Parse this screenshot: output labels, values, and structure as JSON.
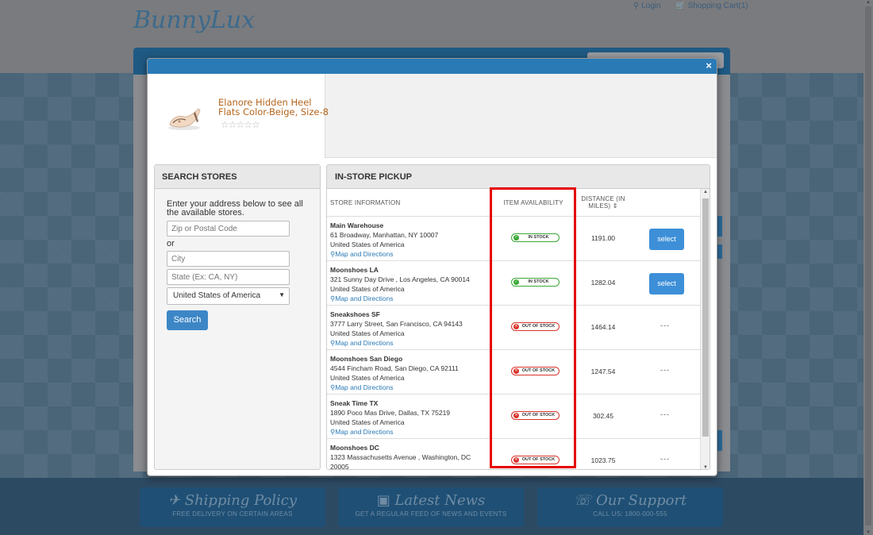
{
  "background": {
    "logo": "BunnyLux",
    "links": {
      "login": "Login",
      "cart": "Shopping Cart(1)"
    },
    "footer": [
      {
        "title": "Shipping Policy",
        "sub": "FREE DELIVERY ON CERTAIN AREAS"
      },
      {
        "title": "Latest News",
        "sub": "GET A REGULAR FEED OF NEWS AND EVENTS"
      },
      {
        "title": "Our Support",
        "sub": "CALL US: 1800-000-555"
      }
    ]
  },
  "modal": {
    "close_label": "×",
    "product": {
      "name": "Elanore Hidden Heel Flats Color-Beige, Size-8",
      "stars": "☆☆☆☆☆"
    },
    "search": {
      "title": "SEARCH STORES",
      "intro": "Enter your address below to see all the available stores.",
      "zip_placeholder": "Zip or Postal Code",
      "or": "or",
      "city_placeholder": "City",
      "state_placeholder": "State (Ex: CA, NY)",
      "country": "United States of America",
      "button": "Search"
    },
    "pickup": {
      "title": "IN-STORE PICKUP",
      "headers": {
        "store": "STORE INFORMATION",
        "availability": "ITEM AVAILABILITY",
        "distance": "DISTANCE (IN MILES)"
      },
      "stores": [
        {
          "name": "Main Warehouse",
          "address": "61 Broadway, Manhattan, NY 10007",
          "country": "United States of America",
          "link": "Map and Directions",
          "availability": "IN STOCK",
          "distance": "1191.00",
          "action": "select"
        },
        {
          "name": "Moonshoes LA",
          "address": "321 Sunny Day Drive , Los Angeles, CA 90014",
          "country": "United States of America",
          "link": "Map and Directions",
          "availability": "IN STOCK",
          "distance": "1282.04",
          "action": "select"
        },
        {
          "name": "Sneakshoes SF",
          "address": "3777 Larry Street, San Francisco, CA 94143",
          "country": "United States of America",
          "link": "Map and Directions",
          "availability": "OUT OF STOCK",
          "distance": "1464.14",
          "action": "---"
        },
        {
          "name": "Moonshoes San Diego",
          "address": "4544 Fincham Road, San Diego, CA 92111",
          "country": "United States of America",
          "link": "Map and Directions",
          "availability": "OUT OF STOCK",
          "distance": "1247.54",
          "action": "---"
        },
        {
          "name": "Sneak Time TX",
          "address": "1890 Poco Mas Drive, Dallas, TX 75219",
          "country": "United States of America",
          "link": "Map and Directions",
          "availability": "OUT OF STOCK",
          "distance": "302.45",
          "action": "---"
        },
        {
          "name": "Moonshoes DC",
          "address": "1323 Massachusetts Avenue , Washington, DC",
          "country": "20005",
          "link": "",
          "availability": "OUT OF STOCK",
          "distance": "1023.75",
          "action": "---"
        }
      ]
    }
  },
  "colors": {
    "header_blue": "#2a7ab6",
    "button_blue": "#3d8fd8",
    "in_stock_green": "#3aa935",
    "out_of_stock_red": "#d9342b",
    "highlight_red": "#e60000",
    "product_name": "#b5651d"
  }
}
